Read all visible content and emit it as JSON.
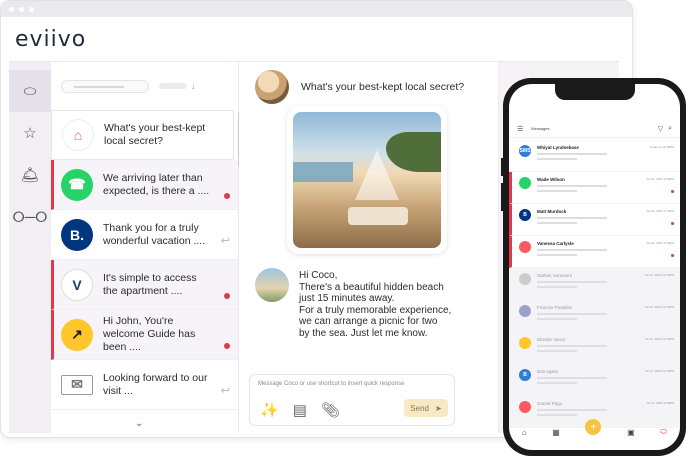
{
  "app": {
    "logo": "eviivo"
  },
  "list": {
    "conversations": [
      {
        "text": "What's your best-kept local secret?",
        "brand": "airbnb",
        "color": "#ff5a5f",
        "unread": false,
        "mark": "none"
      },
      {
        "text": "We arriving later than expected, is there a ....",
        "brand": "whatsapp",
        "color": "#25d366",
        "unread": true,
        "mark": "dot"
      },
      {
        "text": "Thank you for a truly wonderful vacation ....",
        "brand": "booking",
        "color": "#003580",
        "avatar_label": "B.",
        "unread": false,
        "mark": "reply"
      },
      {
        "text": "It's simple to access the apartment ....",
        "brand": "vrbo",
        "color": "#ffffff",
        "avatar_label": "V",
        "unread": true,
        "mark": "dot"
      },
      {
        "text": "Hi John, You're welcome Guide has been ....",
        "brand": "expedia",
        "color": "#ffc72c",
        "unread": true,
        "mark": "dot"
      },
      {
        "text": "Looking forward to our visit ...",
        "brand": "email",
        "color": "#ffffff",
        "unread": false,
        "mark": "reply"
      }
    ]
  },
  "chat": {
    "question": "What's your best-kept local secret?",
    "reply_lines": [
      "Hi Coco,",
      "There's a beautiful hidden beach",
      "just 15 minutes away.",
      "For a truly memorable experience,",
      "we can arrange a picnic for two",
      "by the sea. Just let me know."
    ],
    "composer_placeholder": "Message Coco or use shortcut to insert quick response",
    "send_label": "Send"
  },
  "phone": {
    "title": "Messages",
    "rows": [
      {
        "name": "Whiyat Lyndsebase",
        "label": "SMS",
        "color": "#2f7fd6",
        "unread": false,
        "grey": false,
        "date": "Today at 12:45PM"
      },
      {
        "name": "Wade Wilson",
        "color": "#25d366",
        "unread": true,
        "grey": false,
        "date": "Jul 22, 2023 4:00PM"
      },
      {
        "name": "Matt Murdock",
        "label": "B",
        "color": "#003580",
        "unread": true,
        "grey": false,
        "date": "Jul 20, 2023 4:16PM"
      },
      {
        "name": "Vanessa Carlysle",
        "color": "#ff5a5f",
        "unread": true,
        "grey": false,
        "date": "Jul 29, 2023 4:25PM"
      },
      {
        "name": "Nathan Summers",
        "color": "#cccccc",
        "unread": false,
        "grey": true,
        "date": "Jul 12, 2023 12:30PM"
      },
      {
        "name": "Frances Paradise",
        "color": "#9aa3c7",
        "unread": false,
        "grey": true,
        "date": "Jul 13, 2023 12:30PM"
      },
      {
        "name": "Blondie Vasco",
        "color": "#ffc72c",
        "unread": false,
        "grey": true,
        "date": "Jul 11, 2023 12:30PM"
      },
      {
        "name": "Bob Agent",
        "label": "B",
        "color": "#2f7fd6",
        "unread": false,
        "grey": true,
        "date": "Jul 17, 2023 11:33PM"
      },
      {
        "name": "Joanet Pago",
        "color": "#ff5a5f",
        "unread": false,
        "grey": true,
        "date": "Jul 15, 2023 3:00PM"
      }
    ]
  }
}
